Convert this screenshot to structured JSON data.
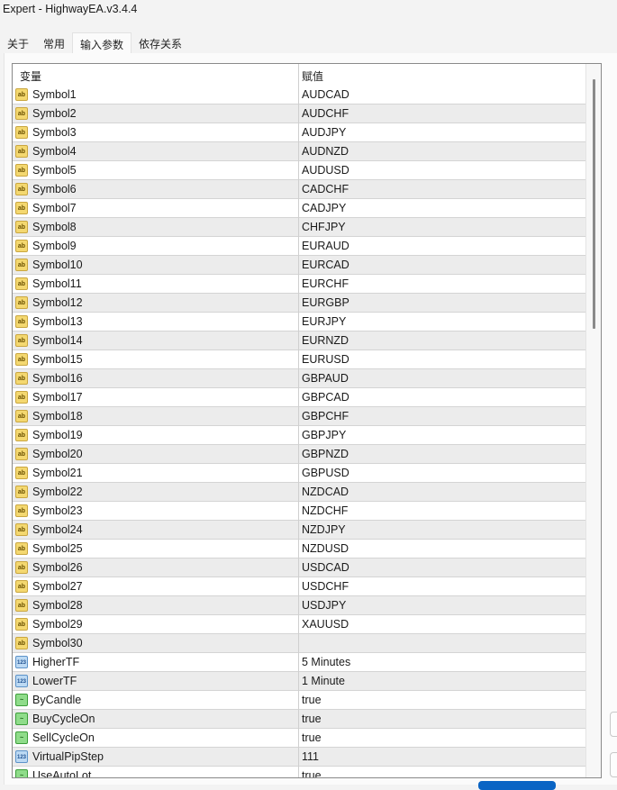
{
  "window": {
    "title": "Expert - HighwayEA.v3.4.4"
  },
  "tabs": [
    {
      "label": "关于"
    },
    {
      "label": "常用"
    },
    {
      "label": "输入参数",
      "active": true
    },
    {
      "label": "依存关系"
    }
  ],
  "table": {
    "headers": {
      "variable": "变量",
      "value": "赋值"
    },
    "rows": [
      {
        "type": "ab",
        "name": "Symbol1",
        "value": "AUDCAD"
      },
      {
        "type": "ab",
        "name": "Symbol2",
        "value": "AUDCHF"
      },
      {
        "type": "ab",
        "name": "Symbol3",
        "value": "AUDJPY"
      },
      {
        "type": "ab",
        "name": "Symbol4",
        "value": "AUDNZD"
      },
      {
        "type": "ab",
        "name": "Symbol5",
        "value": "AUDUSD"
      },
      {
        "type": "ab",
        "name": "Symbol6",
        "value": "CADCHF"
      },
      {
        "type": "ab",
        "name": "Symbol7",
        "value": "CADJPY"
      },
      {
        "type": "ab",
        "name": "Symbol8",
        "value": "CHFJPY"
      },
      {
        "type": "ab",
        "name": "Symbol9",
        "value": "EURAUD"
      },
      {
        "type": "ab",
        "name": "Symbol10",
        "value": "EURCAD"
      },
      {
        "type": "ab",
        "name": "Symbol11",
        "value": "EURCHF"
      },
      {
        "type": "ab",
        "name": "Symbol12",
        "value": "EURGBP"
      },
      {
        "type": "ab",
        "name": "Symbol13",
        "value": "EURJPY"
      },
      {
        "type": "ab",
        "name": "Symbol14",
        "value": "EURNZD"
      },
      {
        "type": "ab",
        "name": "Symbol15",
        "value": "EURUSD"
      },
      {
        "type": "ab",
        "name": "Symbol16",
        "value": "GBPAUD"
      },
      {
        "type": "ab",
        "name": "Symbol17",
        "value": "GBPCAD"
      },
      {
        "type": "ab",
        "name": "Symbol18",
        "value": "GBPCHF"
      },
      {
        "type": "ab",
        "name": "Symbol19",
        "value": "GBPJPY"
      },
      {
        "type": "ab",
        "name": "Symbol20",
        "value": "GBPNZD"
      },
      {
        "type": "ab",
        "name": "Symbol21",
        "value": "GBPUSD"
      },
      {
        "type": "ab",
        "name": "Symbol22",
        "value": "NZDCAD"
      },
      {
        "type": "ab",
        "name": "Symbol23",
        "value": "NZDCHF"
      },
      {
        "type": "ab",
        "name": "Symbol24",
        "value": "NZDJPY"
      },
      {
        "type": "ab",
        "name": "Symbol25",
        "value": "NZDUSD"
      },
      {
        "type": "ab",
        "name": "Symbol26",
        "value": "USDCAD"
      },
      {
        "type": "ab",
        "name": "Symbol27",
        "value": "USDCHF"
      },
      {
        "type": "ab",
        "name": "Symbol28",
        "value": "USDJPY"
      },
      {
        "type": "ab",
        "name": "Symbol29",
        "value": "XAUUSD"
      },
      {
        "type": "ab",
        "name": "Symbol30",
        "value": ""
      },
      {
        "type": "n",
        "name": "HigherTF",
        "value": "5 Minutes"
      },
      {
        "type": "n",
        "name": "LowerTF",
        "value": "1 Minute"
      },
      {
        "type": "b",
        "name": "ByCandle",
        "value": "true"
      },
      {
        "type": "b",
        "name": "BuyCycleOn",
        "value": "true"
      },
      {
        "type": "b",
        "name": "SellCycleOn",
        "value": "true"
      },
      {
        "type": "n",
        "name": "VirtualPipStep",
        "value": "111"
      },
      {
        "type": "b",
        "name": "UseAutoLot",
        "value": "true"
      }
    ]
  },
  "icons": {
    "ab": "ab",
    "n": "123",
    "b": "~"
  }
}
